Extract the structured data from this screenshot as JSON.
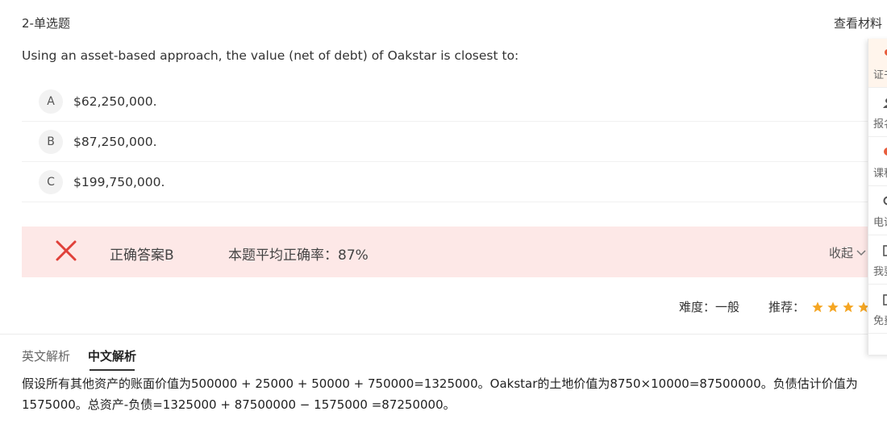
{
  "header": {
    "question_type": "2-单选题",
    "view_material": "查看材料"
  },
  "question": {
    "stem": "Using an asset-based approach, the value (net of debt) of Oakstar is closest to:",
    "options": [
      {
        "letter": "A",
        "text": "$62,250,000."
      },
      {
        "letter": "B",
        "text": "$87,250,000."
      },
      {
        "letter": "C",
        "text": "$199,750,000."
      }
    ]
  },
  "result": {
    "status_icon": "x-icon",
    "status_color": "#e0403a",
    "correct_answer": "正确答案B",
    "average_rate": "本题平均正确率：87%",
    "collapse_label": "收起"
  },
  "meta": {
    "difficulty": "难度：一般",
    "recommend_label": "推荐：",
    "star_color": "#f5a623",
    "stars": 4
  },
  "tabs": [
    {
      "label": "英文解析",
      "active": false
    },
    {
      "label": "中文解析",
      "active": true
    }
  ],
  "analysis": {
    "text": "假设所有其他资产的账面价值为500000 + 25000 + 50000 + 750000=1325000。Oakstar的土地价值为8750×10000=87500000。负债估计价值为1575000。总资产-负债=1325000 + 87500000 − 1575000 =87250000。"
  },
  "side_panel": {
    "accent_color": "#e85d3d",
    "items": [
      {
        "label": "证书",
        "icon": "certificate-icon"
      },
      {
        "label": "报名",
        "icon": "user-icon"
      },
      {
        "label": "课程",
        "icon": "course-icon"
      },
      {
        "label": "电话",
        "icon": "phone-icon"
      },
      {
        "label": "我要",
        "icon": "note-icon"
      },
      {
        "label": "免费",
        "icon": "document-icon"
      }
    ]
  }
}
